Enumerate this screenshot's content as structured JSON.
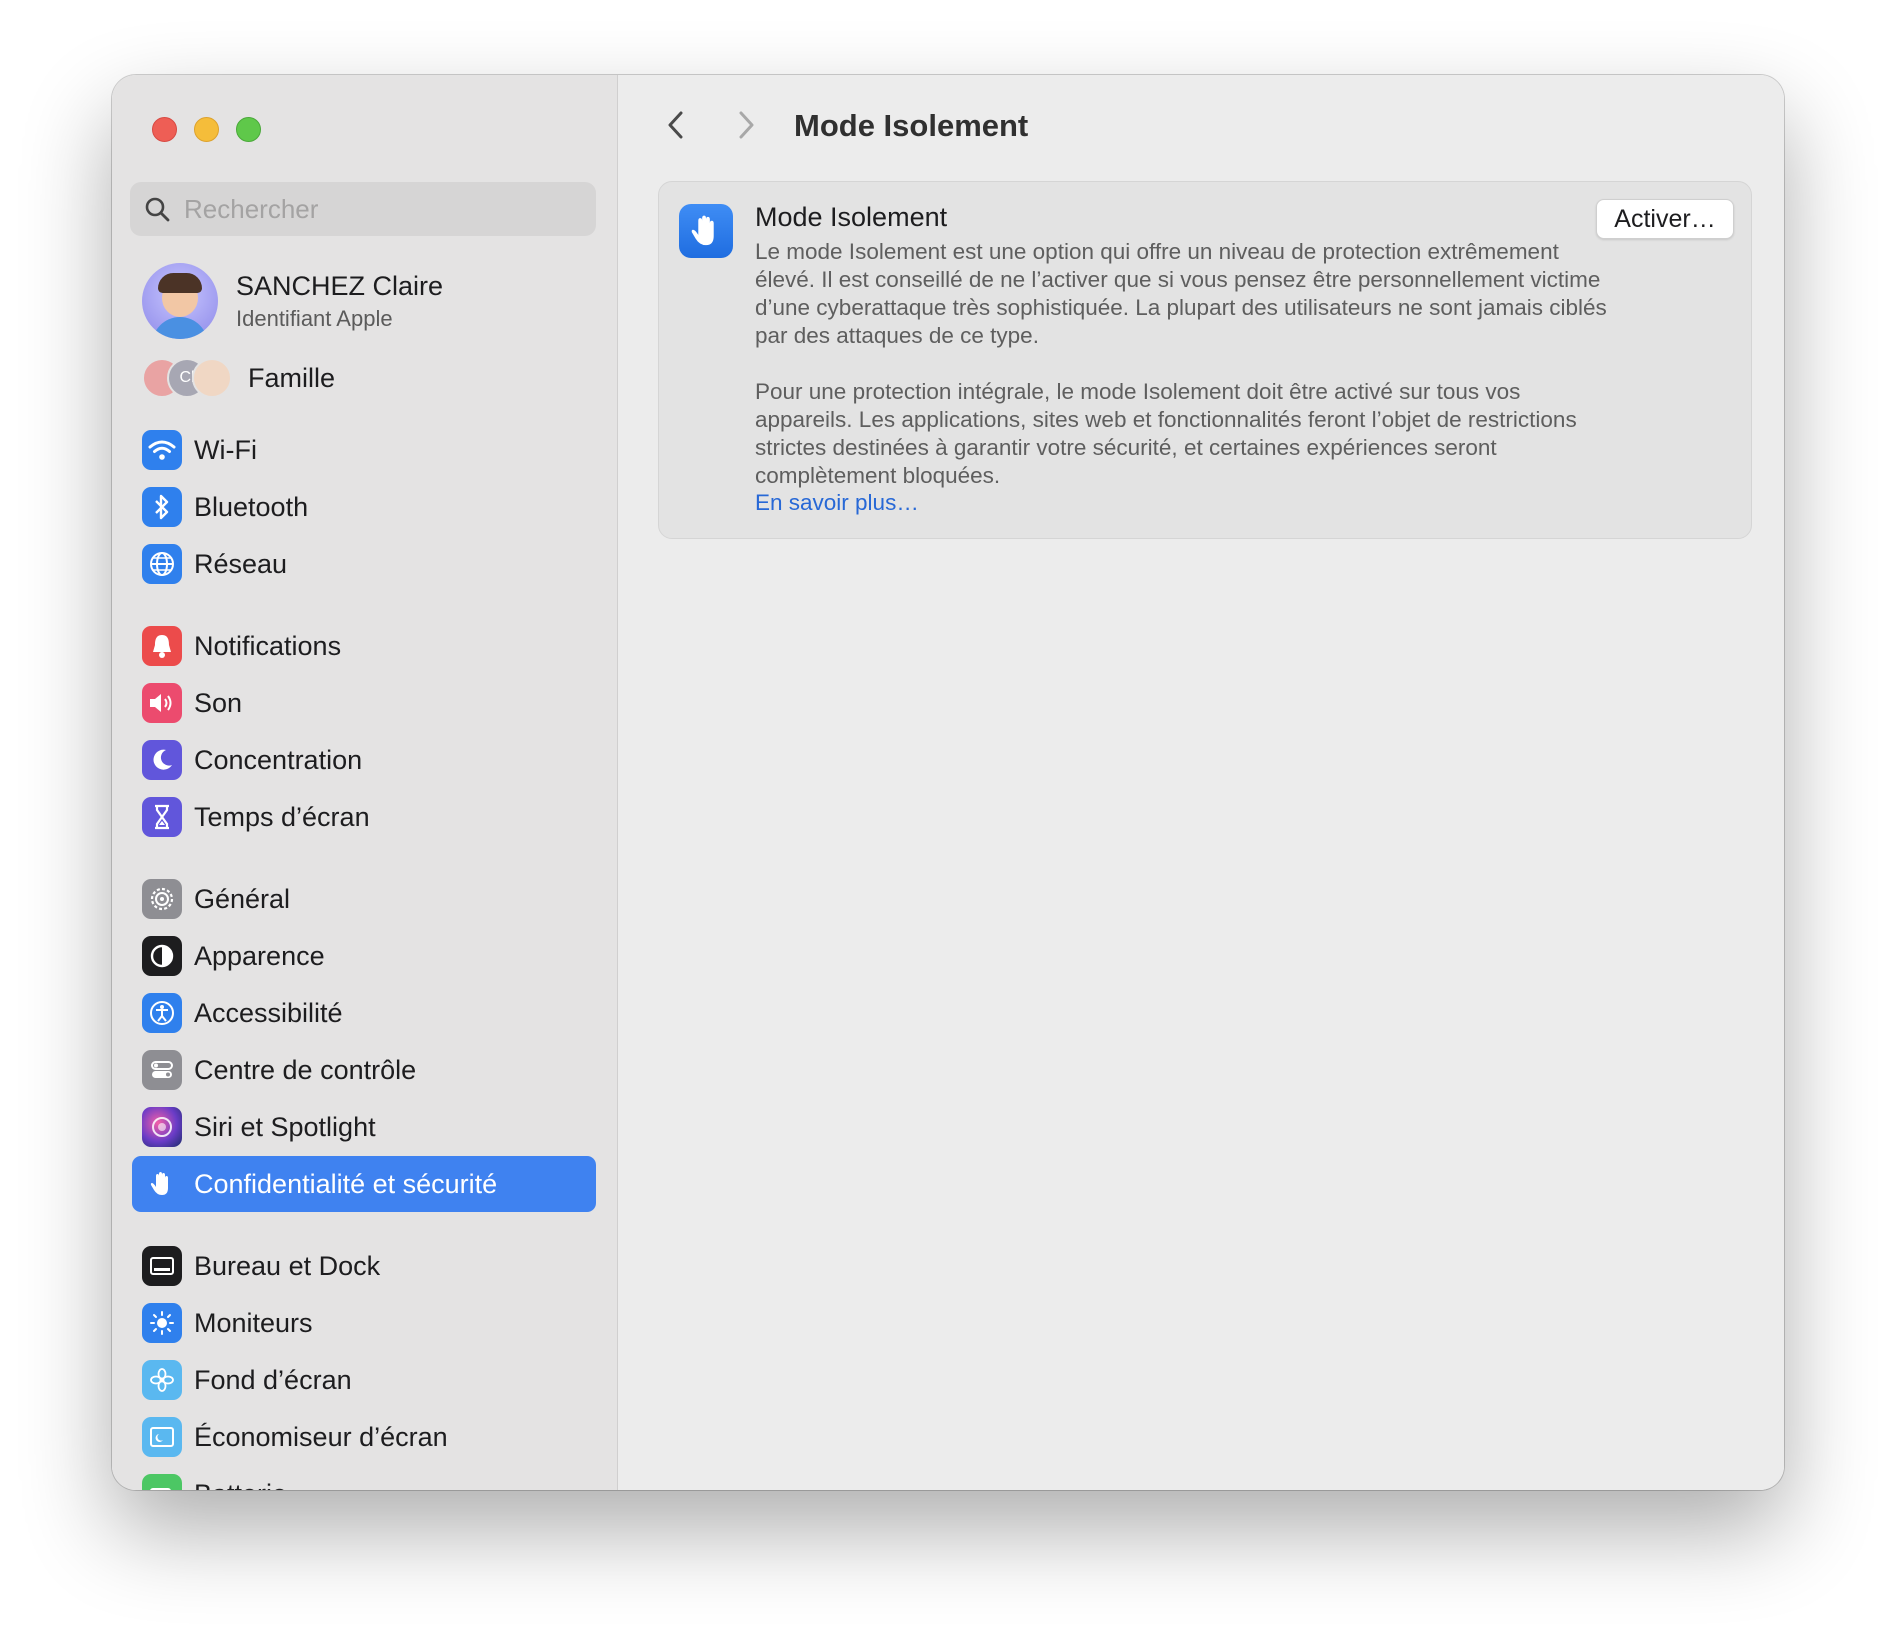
{
  "window": {
    "traffic_lights": [
      "close",
      "minimize",
      "zoom"
    ]
  },
  "search": {
    "placeholder": "Rechercher"
  },
  "user": {
    "name": "SANCHEZ Claire",
    "subtitle": "Identifiant Apple"
  },
  "family": {
    "label": "Famille",
    "avatar_initials": "Cl"
  },
  "sidebar": {
    "items": [
      {
        "label": "Wi-Fi",
        "icon": "wifi-icon",
        "color": "#2f80ed",
        "selected": false
      },
      {
        "label": "Bluetooth",
        "icon": "bluetooth-icon",
        "color": "#2f80ed",
        "selected": false
      },
      {
        "label": "Réseau",
        "icon": "globe-icon",
        "color": "#2f80ed",
        "selected": false
      },
      {
        "label": "Notifications",
        "icon": "bell-icon",
        "color": "#ec4b4b",
        "selected": false
      },
      {
        "label": "Son",
        "icon": "speaker-icon",
        "color": "#ec4b6e",
        "selected": false
      },
      {
        "label": "Concentration",
        "icon": "moon-icon",
        "color": "#6156db",
        "selected": false
      },
      {
        "label": "Temps d’écran",
        "icon": "hourglass-icon",
        "color": "#6156db",
        "selected": false
      },
      {
        "label": "Général",
        "icon": "gear-icon",
        "color": "#8e8e93",
        "selected": false
      },
      {
        "label": "Apparence",
        "icon": "appearance-icon",
        "color": "#1d1d1f",
        "selected": false
      },
      {
        "label": "Accessibilité",
        "icon": "accessibility-icon",
        "color": "#2f80ed",
        "selected": false
      },
      {
        "label": "Centre de contrôle",
        "icon": "control-center-icon",
        "color": "#8e8e93",
        "selected": false
      },
      {
        "label": "Siri et Spotlight",
        "icon": "siri-icon",
        "color": "#6a3cc7",
        "selected": false
      },
      {
        "label": "Confidentialité et sécurité",
        "icon": "hand-icon",
        "color": "#3f82f0",
        "selected": true
      },
      {
        "label": "Bureau et Dock",
        "icon": "dock-icon",
        "color": "#1d1d1f",
        "selected": false
      },
      {
        "label": "Moniteurs",
        "icon": "sun-icon",
        "color": "#2f80ed",
        "selected": false
      },
      {
        "label": "Fond d’écran",
        "icon": "flower-icon",
        "color": "#5ab8f0",
        "selected": false
      },
      {
        "label": "Économiseur d’écran",
        "icon": "screensaver-icon",
        "color": "#5ab8f0",
        "selected": false
      },
      {
        "label": "Batterie",
        "icon": "battery-icon",
        "color": "#4cc764",
        "selected": false
      }
    ]
  },
  "header": {
    "title": "Mode Isolement"
  },
  "panel": {
    "title": "Mode Isolement",
    "paragraph1": "Le mode Isolement est une option qui offre un niveau de protection extrêmement élevé. Il est conseillé de ne l’activer que si vous pensez être personnellement victime d’une cyberattaque très sophistiquée. La plupart des utilisateurs ne sont jamais ciblés par des attaques de ce type.",
    "paragraph2": "Pour une protection intégrale, le mode Isolement doit être activé sur tous vos appareils. Les applications, sites web et fonctionnalités feront l’objet de restrictions strictes destinées à garantir votre sécurité, et certaines expériences seront complètement bloquées.",
    "link": "En savoir plus…",
    "button": "Activer…"
  },
  "colors": {
    "accent": "#3f82f0",
    "link": "#2768d6"
  }
}
